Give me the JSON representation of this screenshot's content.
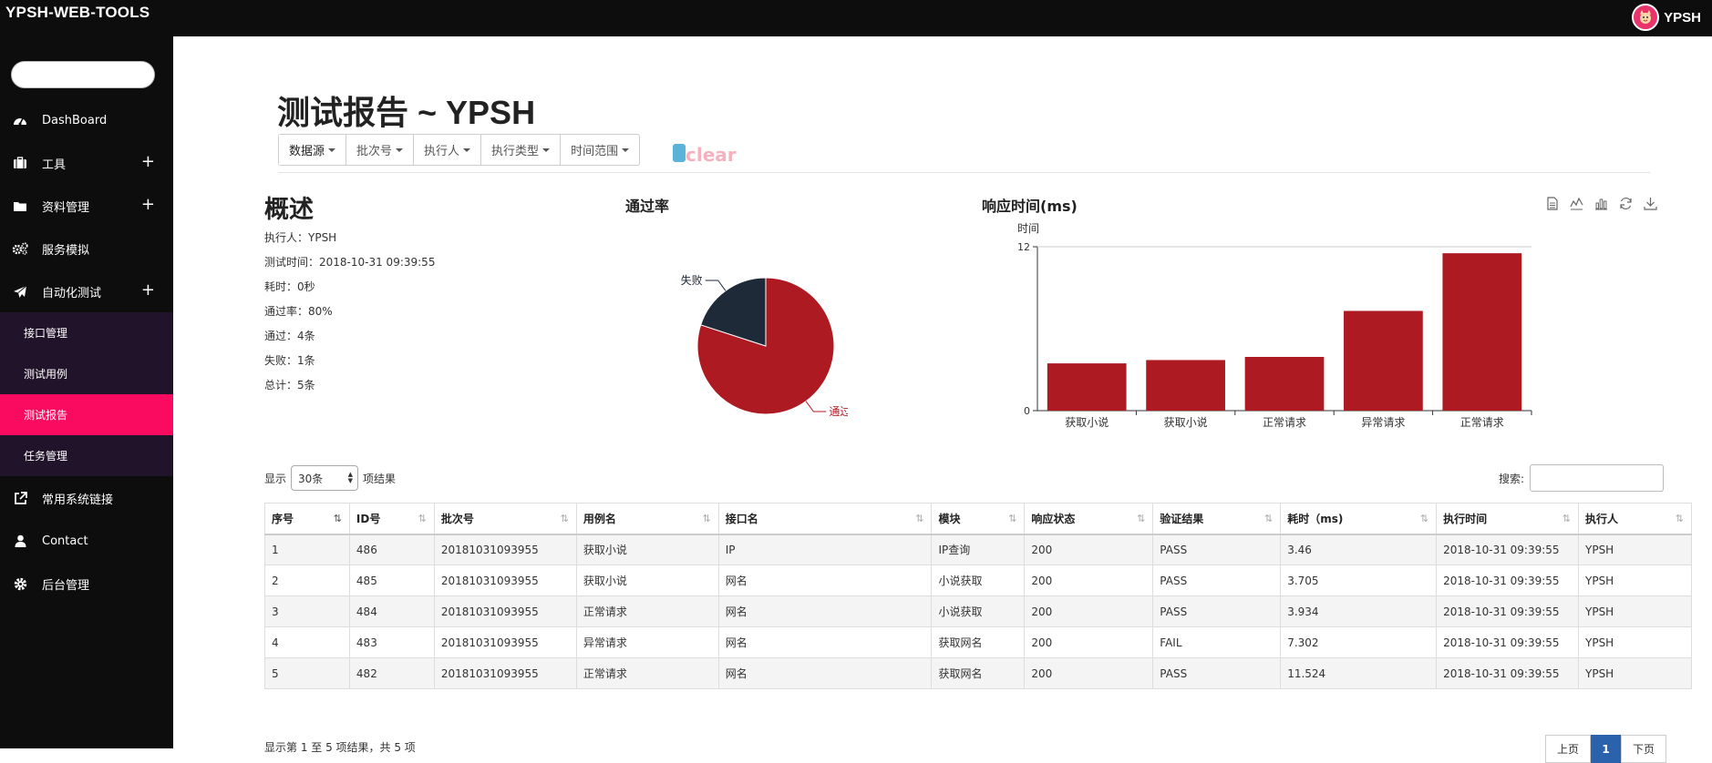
{
  "app": {
    "brand": "YPSH-WEB-TOOLS",
    "user": "YPSH"
  },
  "sidebar": {
    "items": [
      {
        "label": "DashBoard",
        "icon": "dashboard-icon",
        "expandable": false
      },
      {
        "label": "工具",
        "icon": "briefcase-icon",
        "expandable": true
      },
      {
        "label": "资料管理",
        "icon": "folder-icon",
        "expandable": true
      },
      {
        "label": "服务模拟",
        "icon": "gears-icon",
        "expandable": false
      },
      {
        "label": "自动化测试",
        "icon": "paper-plane-icon",
        "expandable": true
      }
    ],
    "subitems": [
      {
        "label": "接口管理",
        "active": false
      },
      {
        "label": "测试用例",
        "active": false
      },
      {
        "label": "测试报告",
        "active": true
      },
      {
        "label": "任务管理",
        "active": false
      }
    ],
    "bottom_items": [
      {
        "label": "常用系统链接",
        "icon": "external-link-icon"
      },
      {
        "label": "Contact",
        "icon": "user-icon"
      },
      {
        "label": "后台管理",
        "icon": "gear-icon"
      }
    ]
  },
  "page": {
    "title": "测试报告 ~ YPSH",
    "filters": [
      "数据源",
      "批次号",
      "执行人",
      "执行类型",
      "时间范围"
    ],
    "clear_label": "clear"
  },
  "summary": {
    "title": "概述",
    "lines": [
      "执行人：YPSH",
      "测试时间：2018-10-31 09:39:55",
      "耗时：0秒",
      "通过率：80%",
      "通过：4条",
      "失败：1条",
      "总计：5条"
    ]
  },
  "chart_data": [
    {
      "type": "pie",
      "title": "通过率",
      "labels": [
        "通过",
        "失败"
      ],
      "values": [
        4,
        1
      ],
      "colors": [
        "#ad1a22",
        "#1f2a38"
      ]
    },
    {
      "type": "bar",
      "title": "响应时间(ms)",
      "ylabel": "时间",
      "categories": [
        "获取小说",
        "获取小说",
        "正常请求",
        "异常请求",
        "正常请求"
      ],
      "values": [
        3.46,
        3.705,
        3.934,
        7.302,
        11.524
      ],
      "ylim": [
        0,
        12
      ],
      "yticks": [
        0,
        12
      ],
      "color": "#ad1a22",
      "toolbox": [
        "data-view-icon",
        "line-chart-icon",
        "bar-chart-icon",
        "refresh-icon",
        "download-icon"
      ]
    }
  ],
  "table": {
    "length_prefix": "显示",
    "length_value": "30条",
    "length_suffix": "项结果",
    "search_label": "搜索:",
    "columns": [
      "序号",
      "ID号",
      "批次号",
      "用例名",
      "接口名",
      "模块",
      "响应状态",
      "验证结果",
      "耗时（ms)",
      "执行时间",
      "执行人"
    ],
    "rows": [
      [
        "1",
        "486",
        "20181031093955",
        "获取小说",
        "IP",
        "IP查询",
        "200",
        "PASS",
        "3.46",
        "2018-10-31 09:39:55",
        "YPSH"
      ],
      [
        "2",
        "485",
        "20181031093955",
        "获取小说",
        "网名",
        "小说获取",
        "200",
        "PASS",
        "3.705",
        "2018-10-31 09:39:55",
        "YPSH"
      ],
      [
        "3",
        "484",
        "20181031093955",
        "正常请求",
        "网名",
        "小说获取",
        "200",
        "PASS",
        "3.934",
        "2018-10-31 09:39:55",
        "YPSH"
      ],
      [
        "4",
        "483",
        "20181031093955",
        "异常请求",
        "网名",
        "获取网名",
        "200",
        "FAIL",
        "7.302",
        "2018-10-31 09:39:55",
        "YPSH"
      ],
      [
        "5",
        "482",
        "20181031093955",
        "正常请求",
        "网名",
        "获取网名",
        "200",
        "PASS",
        "11.524",
        "2018-10-31 09:39:55",
        "YPSH"
      ]
    ],
    "info": "显示第 1 至 5 项结果，共 5 项",
    "pager": {
      "prev": "上页",
      "current": "1",
      "next": "下页"
    }
  }
}
